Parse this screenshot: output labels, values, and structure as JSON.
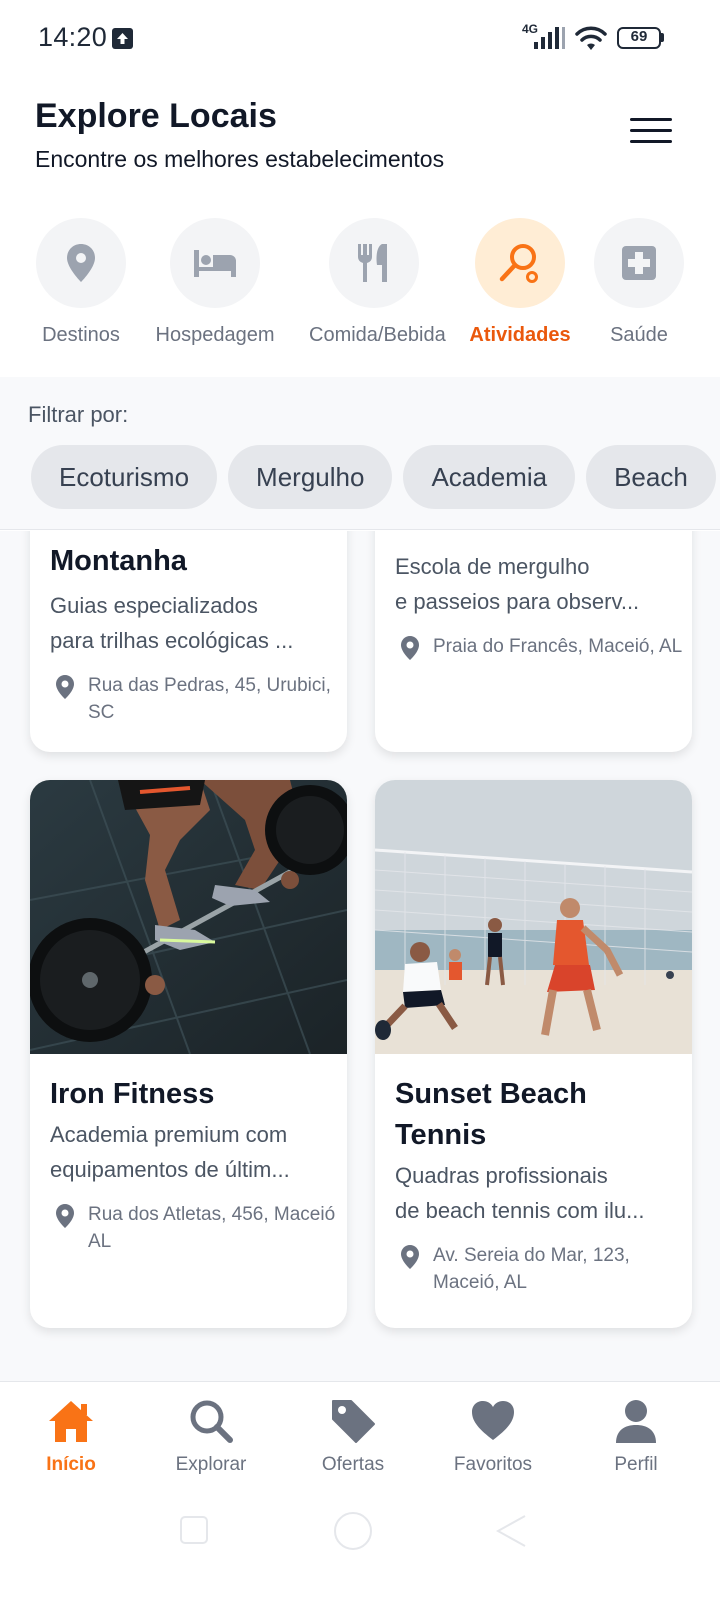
{
  "status_bar": {
    "time": "14:20",
    "network": "4G",
    "battery": "69"
  },
  "header": {
    "title": "Explore Locais",
    "subtitle": "Encontre os melhores estabelecimentos",
    "menu_icon": "hamburger-menu-icon"
  },
  "categories": [
    {
      "label": "Destinos",
      "icon": "map-pin-icon",
      "active": false
    },
    {
      "label": "Hospedagem",
      "icon": "bed-icon",
      "active": false
    },
    {
      "label": "Comida/Bebida",
      "icon": "fork-knife-icon",
      "active": false
    },
    {
      "label": "Atividades",
      "icon": "racket-icon",
      "active": true
    },
    {
      "label": "Saúde",
      "icon": "medical-cross-icon",
      "active": false
    }
  ],
  "filter": {
    "label": "Filtrar por:",
    "chips": [
      "Ecoturismo",
      "Mergulho",
      "Academia",
      "Beach"
    ]
  },
  "cards": [
    {
      "title": "Montanha",
      "description_lines": [
        "Guias especializados",
        "para trilhas ecológicas ..."
      ],
      "location_lines": [
        "Rua das Pedras, 45, Urubici,",
        "SC"
      ]
    },
    {
      "title": "",
      "description_lines": [
        "Escola de mergulho",
        "e passeios para observ..."
      ],
      "location_lines": [
        "Praia do Francês, Maceió, AL"
      ]
    },
    {
      "title": "Iron Fitness",
      "description_lines": [
        "Academia premium com",
        "equipamentos de últim..."
      ],
      "location_lines": [
        "Rua dos Atletas, 456, Maceió",
        "AL"
      ]
    },
    {
      "title": "Sunset Beach Tennis",
      "description_lines": [
        "Quadras profissionais",
        "de beach tennis com ilu..."
      ],
      "location_lines": [
        "Av. Sereia do Mar, 123,",
        "Maceió, AL"
      ]
    }
  ],
  "bottom_nav": [
    {
      "label": "Início",
      "icon": "home-icon",
      "active": true
    },
    {
      "label": "Explorar",
      "icon": "search-icon",
      "active": false
    },
    {
      "label": "Ofertas",
      "icon": "tag-icon",
      "active": false
    },
    {
      "label": "Favoritos",
      "icon": "heart-icon",
      "active": false
    },
    {
      "label": "Perfil",
      "icon": "user-icon",
      "active": false
    }
  ],
  "colors": {
    "accent": "#f97316",
    "accent_dark": "#ea580c",
    "accent_light": "#ffedd5",
    "text_primary": "#111827",
    "text_muted": "#6b7280"
  }
}
